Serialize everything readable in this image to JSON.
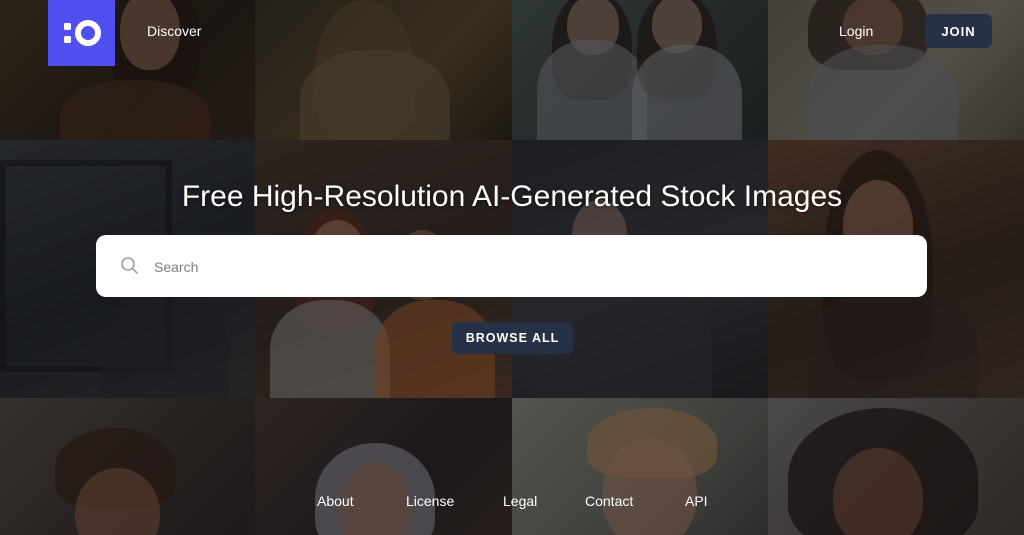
{
  "header": {
    "logo_icon": "brand-logo-icon",
    "logo_color": "#4f4ff0",
    "nav": {
      "discover": "Discover",
      "login": "Login"
    },
    "join_label": "JOIN"
  },
  "hero": {
    "title": "Free High-Resolution AI-Generated Stock Images",
    "search": {
      "placeholder": "Search",
      "value": "",
      "icon": "search-icon"
    },
    "browse_label": "BROWSE ALL"
  },
  "footer": {
    "links": [
      "About",
      "License",
      "Legal",
      "Contact",
      "API"
    ]
  },
  "colors": {
    "accent": "#4f4ff0",
    "button_bg": "#263047",
    "text": "#ffffff"
  }
}
